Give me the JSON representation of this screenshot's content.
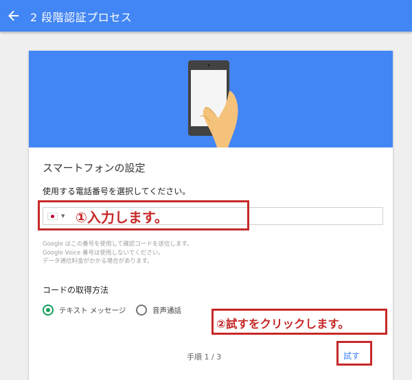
{
  "header": {
    "title": "2 段階認証プロセス"
  },
  "card": {
    "section_title": "スマートフォンの設定",
    "prompt": "使用する電話番号を選択してください。",
    "phone_field": {
      "value": "",
      "placeholder": ""
    },
    "help_lines": [
      "Google はこの番号を使用して確認コードを送信します。",
      "Google Voice 番号は使用しないでください。",
      "データ通信料金がかかる場合があります。"
    ],
    "method_title": "コードの取得方法",
    "methods": [
      {
        "label": "テキスト メッセージ",
        "selected": true
      },
      {
        "label": "音声通話",
        "selected": false
      }
    ],
    "step_text": "手順 1 / 3",
    "try_label": "試す"
  },
  "annotations": {
    "callout_1": "①入力します。",
    "callout_2": "②試すをクリックします。"
  },
  "colors": {
    "primary": "#4285f4",
    "radio_selected": "#0f9d58",
    "annotation": "#c62828"
  }
}
